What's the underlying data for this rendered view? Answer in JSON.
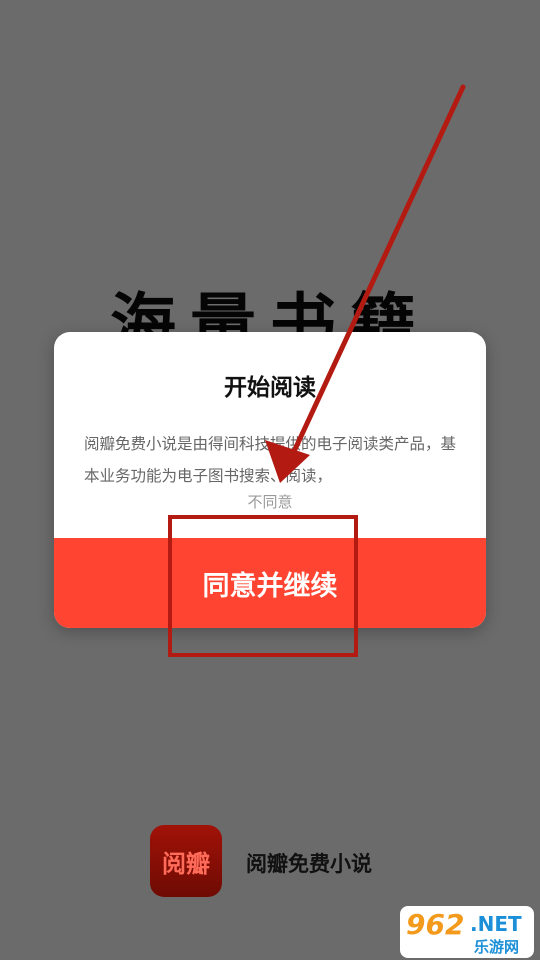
{
  "background": {
    "headline": "海量书籍"
  },
  "dialog": {
    "title": "开始阅读",
    "body": "阅瓣免费小说是由得间科技提供的电子阅读类产品，基本业务功能为电子图书搜索、阅读，",
    "disagree_label": "不同意",
    "agree_label": "同意并继续"
  },
  "brand": {
    "logo_text": "阅瓣",
    "name": "阅瓣免费小说"
  },
  "watermark": {
    "number": "962",
    "domain": ".NET",
    "subtitle": "乐游网"
  },
  "colors": {
    "accent": "#ff4431",
    "annotation": "#b31b12",
    "overlay": "#6b6b6b"
  }
}
